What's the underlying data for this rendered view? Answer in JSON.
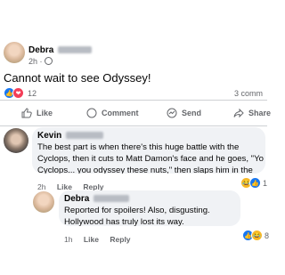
{
  "post": {
    "author_first": "Debra",
    "time": "2h",
    "privacy_sep": "·",
    "text": "Cannot wait to see Odyssey!",
    "reactions_count": "12",
    "comments_count": "3 comm",
    "actions": {
      "like": "Like",
      "comment": "Comment",
      "send": "Send",
      "share": "Share"
    }
  },
  "comments": [
    {
      "author_first": "Kevin",
      "text": "The best part is when there's this huge battle with the Cyclops, then it cuts to Matt Damon's face and he goes, \"Yo Cyclops... you odyssey these nuts,\" then slaps him in the face with his sack.",
      "time": "2h",
      "like_label": "Like",
      "reply_label": "Reply",
      "reaction_count": "1"
    },
    {
      "author_first": "Debra",
      "text": "Reported for spoilers! Also, disgusting. Hollywood has truly lost its way.",
      "time": "1h",
      "like_label": "Like",
      "reply_label": "Reply",
      "reaction_count": "8"
    }
  ],
  "colors": {
    "like_blue": "#1877f2",
    "love_red": "#f33e58",
    "haha_yellow": "#f7b928",
    "muted": "#65676b"
  }
}
